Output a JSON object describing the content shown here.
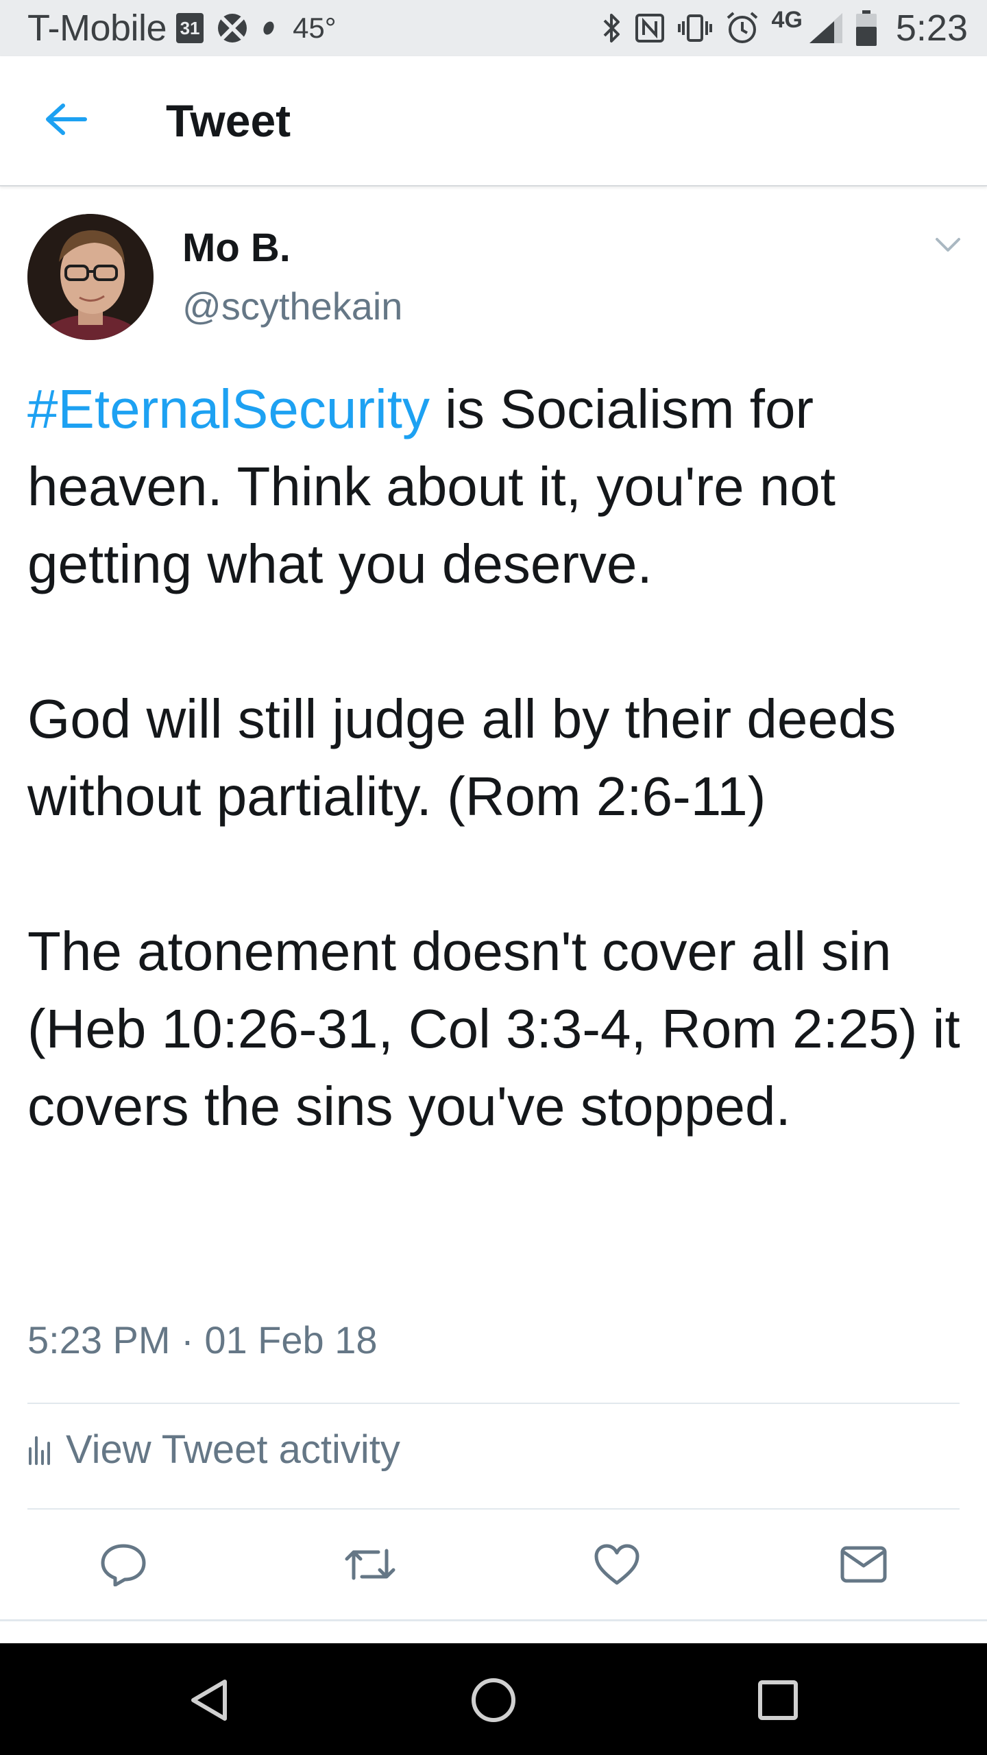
{
  "status_bar": {
    "carrier": "T-Mobile",
    "calendar_day": "31",
    "temperature": "45°",
    "network": "4G",
    "time": "5:23",
    "icons": [
      "calendar-icon",
      "xbox-icon",
      "location-dot-icon",
      "bluetooth-icon",
      "nfc-icon",
      "vibrate-icon",
      "alarm-icon",
      "signal-icon",
      "battery-icon"
    ]
  },
  "header": {
    "title": "Tweet",
    "back_icon": "arrow-left-icon"
  },
  "tweet": {
    "author_name": "Mo B.",
    "author_handle": "@scythekain",
    "hashtag": "#EternalSecurity",
    "text_p1_rest": " is Socialism for heaven. Think about it, you're not getting what you deserve.",
    "text_p2": "God will still judge all by their deeds without partiality. (Rom 2:6-11)",
    "text_p3": "The atonement doesn't cover all sin (Heb 10:26-31, Col 3:3-4, Rom 2:25) it covers the sins you've stopped.",
    "timestamp": "5:23 PM · 01 Feb 18",
    "activity_label": "View Tweet activity"
  },
  "actions": [
    "reply-icon",
    "retweet-icon",
    "like-icon",
    "direct-message-icon"
  ],
  "colors": {
    "accent": "#1da1f2",
    "text_primary": "#14171a",
    "text_secondary": "#657786",
    "divider": "#e1e8ed",
    "status_bar_bg": "#eaecee",
    "nav_bar_bg": "#000000"
  }
}
